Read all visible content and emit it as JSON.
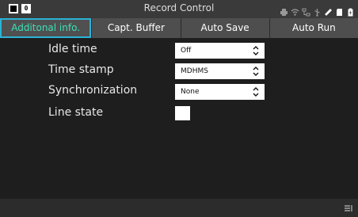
{
  "titlebar": {
    "title": "Record Control",
    "badge": "0"
  },
  "tabs": [
    {
      "label": "Additonal info.",
      "active": true
    },
    {
      "label": "Capt. Buffer",
      "active": false
    },
    {
      "label": "Auto Save",
      "active": false
    },
    {
      "label": "Auto Run",
      "active": false
    }
  ],
  "settings": [
    {
      "label": "Idle time",
      "value": "Off"
    },
    {
      "label": "Time stamp",
      "value": "MDHMS"
    },
    {
      "label": "Synchronization",
      "value": "None"
    },
    {
      "label": "Line state"
    }
  ],
  "colors": {
    "active_tab_text": "#3be1b8",
    "active_tab_border": "#2bb3d6",
    "background": "#1e1e1e",
    "tab_bar": "#4e4e4e",
    "title_bar": "#3a3a3a"
  },
  "icons": [
    "printer-icon",
    "wifi-icon",
    "network-icon",
    "usb-icon",
    "pen-icon",
    "sd-card-icon",
    "battery-icon",
    "menu-icon"
  ]
}
